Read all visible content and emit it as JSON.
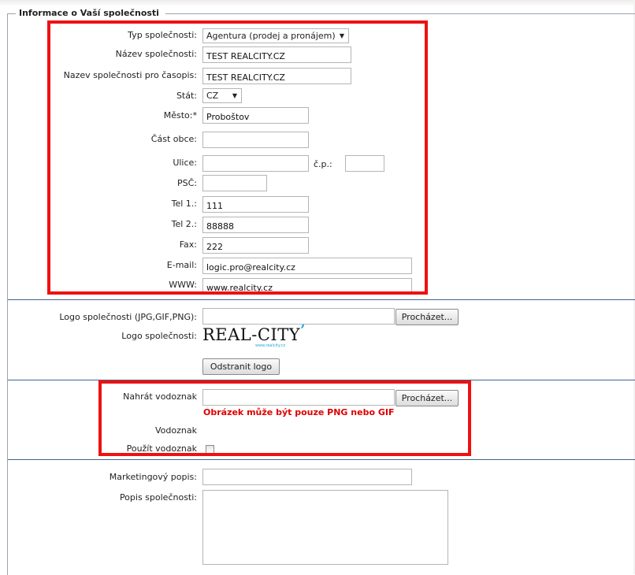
{
  "section_title": "Informace o Vaší společnosti",
  "fields": {
    "typ_spolecnosti": {
      "label": "Typ společnosti:",
      "value": "Agentura (prodej a pronájem)"
    },
    "nazev": {
      "label": "Název společnosti:",
      "value": "TEST REALCITY.CZ"
    },
    "nazev_casopis": {
      "label": "Nazev společnosti pro časopis:",
      "value": "TEST REALCITY.CZ"
    },
    "stat": {
      "label": "Stát:",
      "value": "CZ"
    },
    "mesto": {
      "label": "Město:*",
      "value": "Proboštov"
    },
    "cast_obce": {
      "label": "Část obce:",
      "value": ""
    },
    "ulice": {
      "label": "Ulice:",
      "value": ""
    },
    "cp": {
      "label": "č.p.:",
      "value": ""
    },
    "psc": {
      "label": "PSČ:",
      "value": ""
    },
    "tel1": {
      "label": "Tel 1.:",
      "value": "111"
    },
    "tel2": {
      "label": "Tel 2.:",
      "value": "88888"
    },
    "fax": {
      "label": "Fax:",
      "value": "222"
    },
    "email": {
      "label": "E-mail:",
      "value": "logic.pro@realcity.cz"
    },
    "www": {
      "label": "WWW:",
      "value": "www.realcity.cz"
    }
  },
  "logo": {
    "upload_label": "Logo společnosti (JPG,GIF,PNG):",
    "browse_label": "Procházet...",
    "current_label": "Logo společnosti:",
    "logo_text": "REAL-CITY",
    "logo_sub": "www.realcity.cz",
    "remove_label": "Odstranit logo"
  },
  "watermark": {
    "upload_label": "Nahrát vodoznak",
    "browse_label": "Procházet...",
    "warning": "Obrázek může být pouze PNG nebo GIF",
    "label": "Vodoznak",
    "use_label": "Použít vodoznak",
    "use_checked": false
  },
  "description": {
    "marketing_label": "Marketingový popis:",
    "marketing_value": "",
    "company_label": "Popis společnosti:",
    "company_value": ""
  },
  "colors": {
    "highlight": "#ee1111",
    "warning": "#dd0000",
    "separator": "#40648f",
    "logo_accent": "#1ba9d6"
  }
}
